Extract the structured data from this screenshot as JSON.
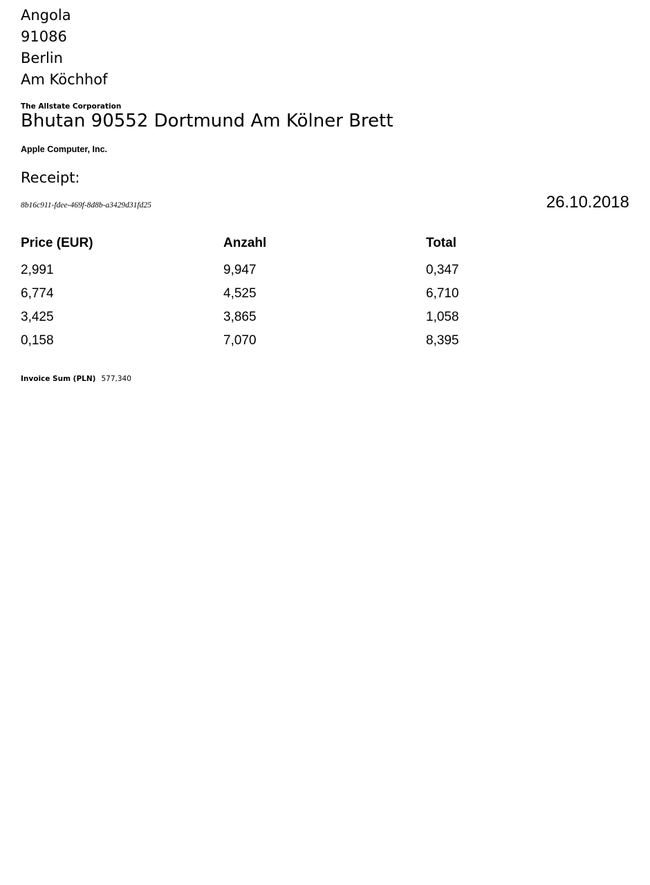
{
  "recipient_address": {
    "country": "Angola",
    "postcode": "91086",
    "city": "Berlin",
    "street": "Am Köchhof"
  },
  "sender": {
    "company": "The Allstate Corporation",
    "address": "Bhutan 90552 Dortmund Am Kölner Brett"
  },
  "recipient_company": "Apple Computer, Inc.",
  "document": {
    "title": "Receipt:",
    "id": "8b16c911-fdee-469f-8d8b-a3429d31fd25",
    "date": "26.10.2018"
  },
  "table": {
    "headers": [
      "Price (EUR)",
      "Anzahl",
      "Total"
    ],
    "rows": [
      [
        "2,991",
        "9,947",
        "0,347"
      ],
      [
        "6,774",
        "4,525",
        "6,710"
      ],
      [
        "3,425",
        "3,865",
        "1,058"
      ],
      [
        "0,158",
        "7,070",
        "8,395"
      ]
    ]
  },
  "summary": {
    "label": "Invoice Sum (PLN)",
    "value": "577,340"
  }
}
